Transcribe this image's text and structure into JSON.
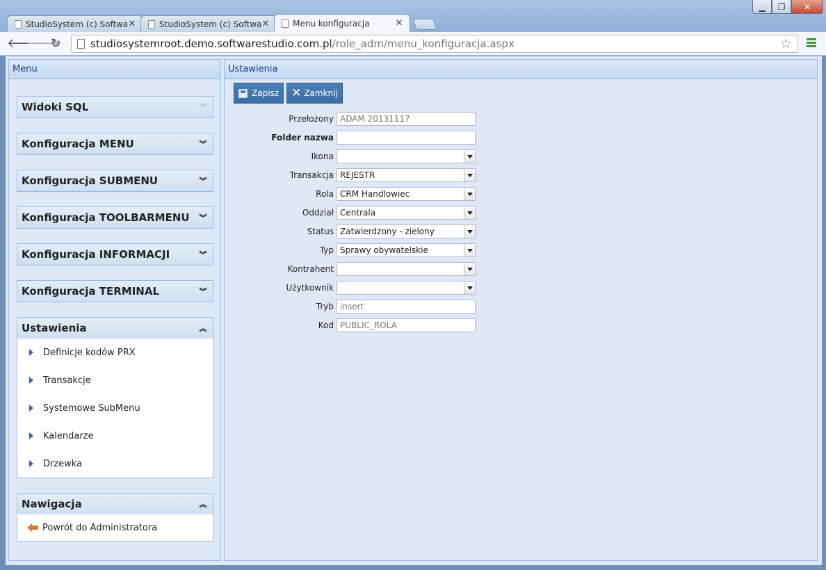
{
  "browser": {
    "tabs": [
      {
        "title": "StudioSystem (c) Software"
      },
      {
        "title": "StudioSystem (c) Software"
      },
      {
        "title": "Menu konfiguracja"
      }
    ],
    "url_host": "studiosystemroot.demo.softwarestudio.com.pl",
    "url_path": "/role_adm/menu_konfiguracja.aspx"
  },
  "left_panel": {
    "title": "Menu",
    "sections": [
      {
        "title": "Widoki SQL"
      },
      {
        "title": "Konfiguracja MENU"
      },
      {
        "title": "Konfiguracja SUBMENU"
      },
      {
        "title": "Konfiguracja TOOLBARMENU"
      },
      {
        "title": "Konfiguracja INFORMACJI"
      },
      {
        "title": "Konfiguracja TERMINAL"
      }
    ],
    "ustawienia": {
      "title": "Ustawienia",
      "items": [
        "Definicje kodów PRX",
        "Transakcje",
        "Systemowe SubMenu",
        "Kalendarze",
        "Drzewka"
      ]
    },
    "nawigacja": {
      "title": "Nawigacja",
      "items": [
        "Powrót do Administratora"
      ]
    }
  },
  "right_panel": {
    "title": "Ustawienia",
    "buttons": {
      "save": "Zapisz",
      "close": "Zamknij"
    },
    "fields": [
      {
        "label": "Przełożony",
        "value": "ADAM 20131117"
      },
      {
        "label": "Folder nazwa",
        "value": ""
      },
      {
        "label": "Ikona",
        "value": ""
      },
      {
        "label": "Transakcja",
        "value": "REJESTR"
      },
      {
        "label": "Rola",
        "value": "CRM Handlowiec"
      },
      {
        "label": "Oddział",
        "value": "Centrala"
      },
      {
        "label": "Status",
        "value": "Zatwierdzony - zielony"
      },
      {
        "label": "Typ",
        "value": "Sprawy obywatelskie"
      },
      {
        "label": "Kontrahent",
        "value": ""
      },
      {
        "label": "Użytkownik",
        "value": ""
      },
      {
        "label": "Tryb",
        "value": "insert"
      },
      {
        "label": "Kod",
        "value": "PUBLIC_ROLA"
      }
    ]
  }
}
